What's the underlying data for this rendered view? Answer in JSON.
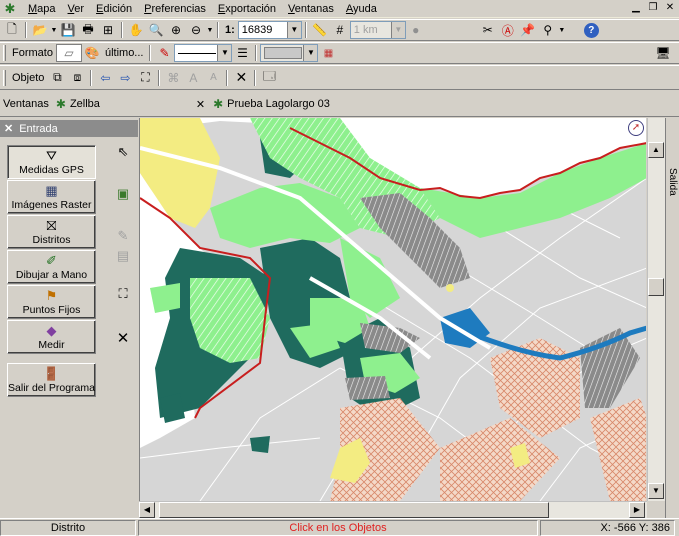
{
  "app": {
    "menu": [
      "Mapa",
      "Ver",
      "Edición",
      "Preferencias",
      "Exportación",
      "Ventanas",
      "Ayuda"
    ]
  },
  "toolbar1": {
    "scale_label": "1:",
    "scale_value": "16839",
    "distance_value": "1 km"
  },
  "toolbar2": {
    "format_label": "Formato",
    "last_label": "último..."
  },
  "toolbar3": {
    "object_label": "Objeto"
  },
  "tabs": {
    "label": "Ventanas",
    "items": [
      "Zellba",
      "Prueba Lagolargo 03"
    ]
  },
  "panel": {
    "title": "Entrada",
    "buttons": [
      "Medidas GPS",
      "Imágenes Raster",
      "Distritos",
      "Dibujar a Mano",
      "Puntos Fijos",
      "Medir",
      "Salir del Programa"
    ]
  },
  "sidetab": {
    "label": "Salida"
  },
  "status": {
    "left": "Distrito",
    "center": "Click en los Objetos",
    "coords": "X: -566  Y: 386"
  },
  "colors": {
    "map_grey": "#d6d6d6",
    "light_green": "#8ef08e",
    "dark_teal": "#1f6b5e",
    "yellow": "#f3ec82",
    "water_blue": "#1e7bbf",
    "boundary_red": "#c81e1e",
    "hatch_orange": "#e8a078"
  }
}
